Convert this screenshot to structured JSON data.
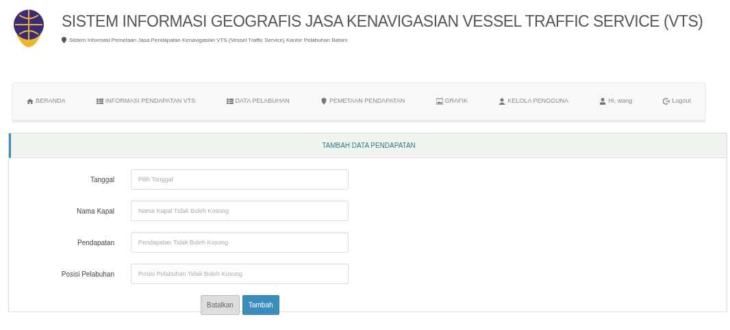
{
  "header": {
    "title": "SISTEM INFORMASI GEOGRAFIS JASA KENAVIGASIAN VESSEL TRAFFIC SERVICE (VTS)",
    "subtitle": "Sistem Informasi Pemetaan Jasa Pendapatan Kenavigasian VTS (Vessel Traffic Service) Kantor Pelabuhan Batam"
  },
  "nav": [
    {
      "kind": "home",
      "label": "BERANDA"
    },
    {
      "kind": "table",
      "label": "INFORMASI PENDAPATAN VTS"
    },
    {
      "kind": "table",
      "label": "DATA PELABUHAN"
    },
    {
      "kind": "pin",
      "label": "PEMETAAN PENDAPATAN"
    },
    {
      "kind": "picture",
      "label": "GRAFIK"
    },
    {
      "kind": "users",
      "label": "KELOLA PENGGUNA"
    },
    {
      "kind": "user",
      "label": "Hi, wang"
    },
    {
      "kind": "logout",
      "label": "Logout"
    }
  ],
  "panel": {
    "title": "TAMBAH DATA PENDAPATAN",
    "fields": [
      {
        "label": "Tanggal",
        "placeholder": "Pilih Tanggal"
      },
      {
        "label": "Nama Kapal",
        "placeholder": "Nama Kapal Tidak Boleh Kosong"
      },
      {
        "label": "Pendapatan",
        "placeholder": "Pendapatan Tidak Boleh Kosong"
      },
      {
        "label": "Posisi Pelabuhan",
        "placeholder": "Posisi Pelabuhan Tidak Boleh Kosong"
      }
    ],
    "buttons": [
      {
        "kind": "cancel",
        "label": "Batalkan"
      },
      {
        "kind": "submit",
        "label": "Tambah"
      }
    ]
  }
}
